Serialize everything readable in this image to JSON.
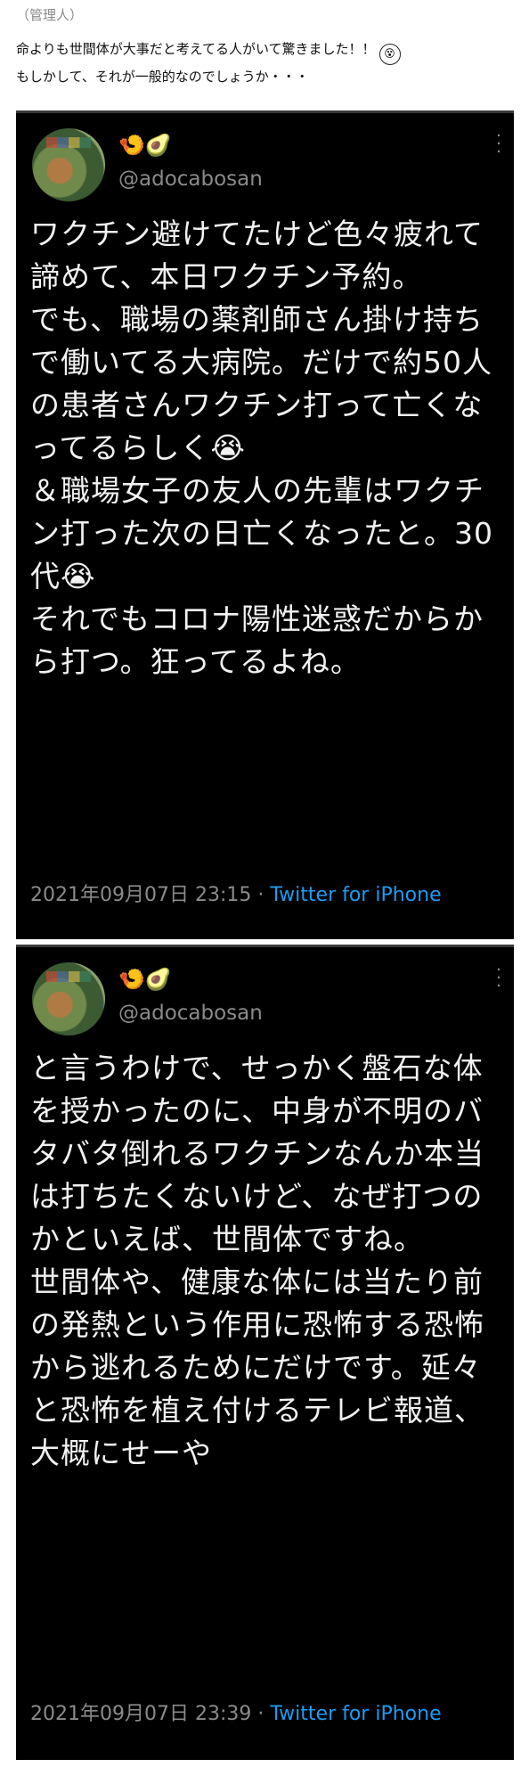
{
  "admin_label": "（管理人）",
  "intro": {
    "line1": "命よりも世間体が大事だと考えてる人がいて驚きました！！",
    "line1_emoji": "😵",
    "line2": "もしかして、それが一般的なのでしょうか・・・"
  },
  "tweets": [
    {
      "emojis": "🍤🥑",
      "handle": "@adocabosan",
      "avatar_icon": "user-avatar-photo",
      "text": "ワクチン避けてたけど色々疲れて諦めて、本日ワクチン予約。\nでも、職場の薬剤師さん掛け持ちで働いてる大病院。だけで約50人の患者さんワクチン打って亡くなってるらしく😭\n＆職場女子の友人の先輩はワクチン打った次の日亡くなったと。30代😭\nそれでもコロナ陽性迷惑だからから打つ。狂ってるよね。",
      "timestamp": "2021年09月07日 23:15",
      "separator": "·",
      "source": "Twitter for iPhone"
    },
    {
      "emojis": "🍤🥑",
      "handle": "@adocabosan",
      "avatar_icon": "user-avatar-photo",
      "text": "と言うわけで、せっかく盤石な体を授かったのに、中身が不明のバタバタ倒れるワクチンなんか本当は打ちたくないけど、なぜ打つのかといえば、世間体ですね。\n世間体や、健康な体には当たり前の発熱という作用に恐怖する恐怖から逃れるためにだけです。延々と恐怖を植え付けるテレビ報道、大概にせーや",
      "timestamp": "2021年09月07日 23:39",
      "separator": "·",
      "source": "Twitter for iPhone"
    }
  ],
  "colors": {
    "panel_bg": "#000000",
    "text": "#f2f2f2",
    "muted": "#8b8b8b",
    "link": "#1d9bf0"
  }
}
